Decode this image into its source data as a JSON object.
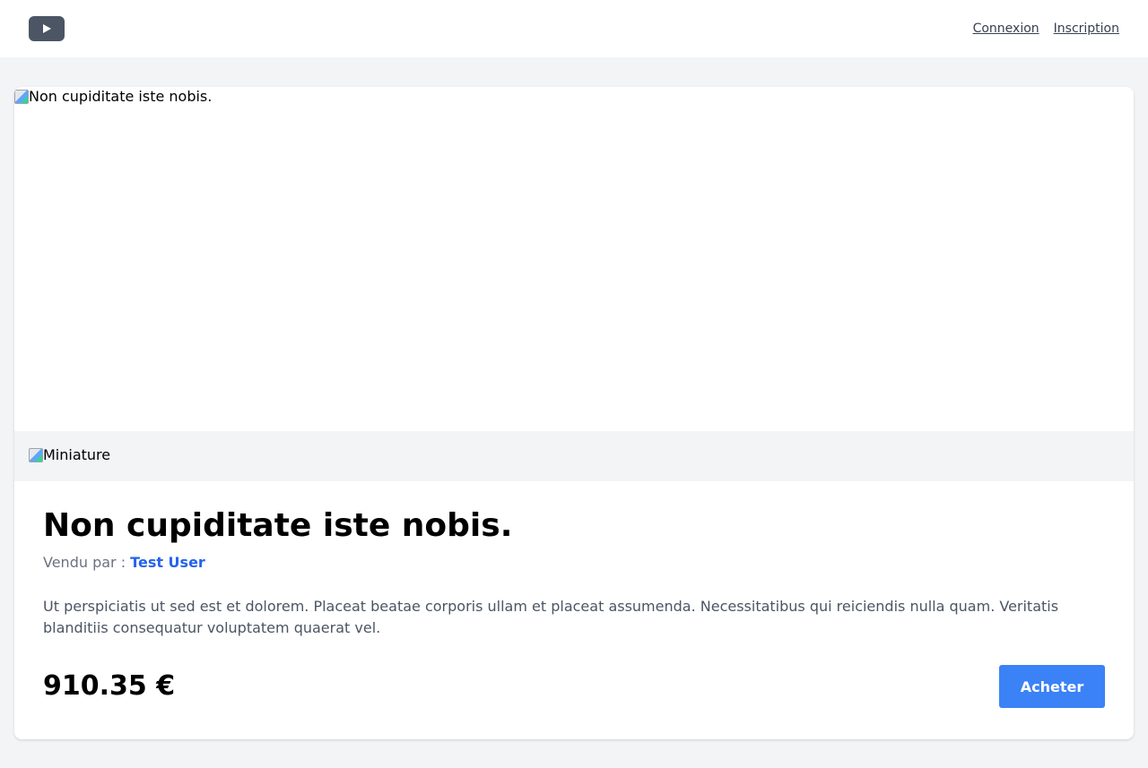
{
  "header": {
    "logo_icon": "play-icon",
    "links": {
      "login": "Connexion",
      "register": "Inscription"
    }
  },
  "product": {
    "main_image_alt": "Non cupiditate iste nobis.",
    "thumbnail_alt": "Miniature",
    "title": "Non cupiditate iste nobis.",
    "seller_label": "Vendu par :",
    "seller_name": "Test User",
    "description": "Ut perspiciatis ut sed est et dolorem. Placeat beatae corporis ullam et placeat assumenda. Necessitatibus qui reiciendis nulla quam. Veritatis blanditiis consequatur voluptatem quaerat vel.",
    "price": "910.35 €",
    "buy_label": "Acheter"
  },
  "colors": {
    "background": "#f3f4f6",
    "logo": "#4b5563",
    "accent": "#3b82f6",
    "seller_link": "#2563eb"
  }
}
